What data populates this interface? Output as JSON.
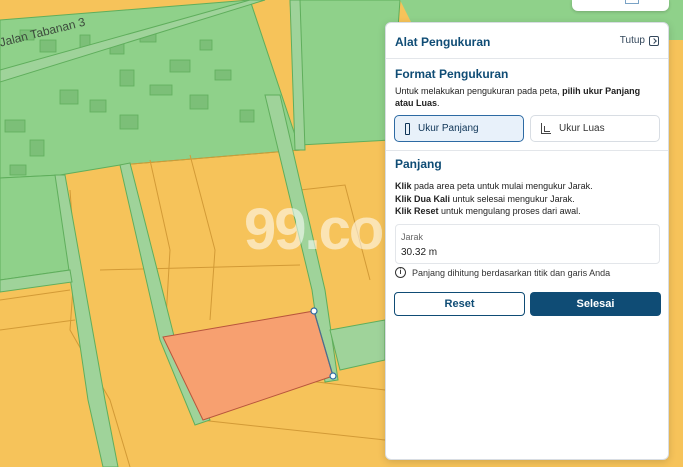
{
  "map": {
    "street_name": "Jalan Tabanan 3",
    "watermark": "99.co",
    "colors": {
      "land": "#f6c35a",
      "green_zone": "#8fd18a",
      "road": "#9fd39a",
      "measured_area": "#f7a070"
    }
  },
  "panel": {
    "title": "Alat Pengukuran",
    "close_label": "Tutup",
    "format_title": "Format Pengukuran",
    "format_desc_prefix": "Untuk melakukan pengukuran pada peta, ",
    "format_desc_bold": "pilih ukur Panjang atau Luas",
    "format_desc_suffix": ".",
    "modes": [
      {
        "label": "Ukur Panjang",
        "icon": "ruler-icon",
        "selected": true
      },
      {
        "label": "Ukur Luas",
        "icon": "area-icon",
        "selected": false
      }
    ],
    "length_title": "Panjang",
    "instructions": [
      {
        "bold": "Klik",
        "text": " pada area peta untuk mulai mengukur Jarak."
      },
      {
        "bold": "Klik Dua Kali",
        "text": " untuk selesai mengukur Jarak."
      },
      {
        "bold": "Klik Reset",
        "text": " untuk mengulang proses dari awal."
      }
    ],
    "distance_label": "Jarak",
    "distance_value": "30.32 m",
    "note": "Panjang dihitung berdasarkan titik dan garis Anda",
    "info_icon": "info-icon",
    "reset_label": "Reset",
    "done_label": "Selesai",
    "accent_color": "#0f4c75"
  }
}
